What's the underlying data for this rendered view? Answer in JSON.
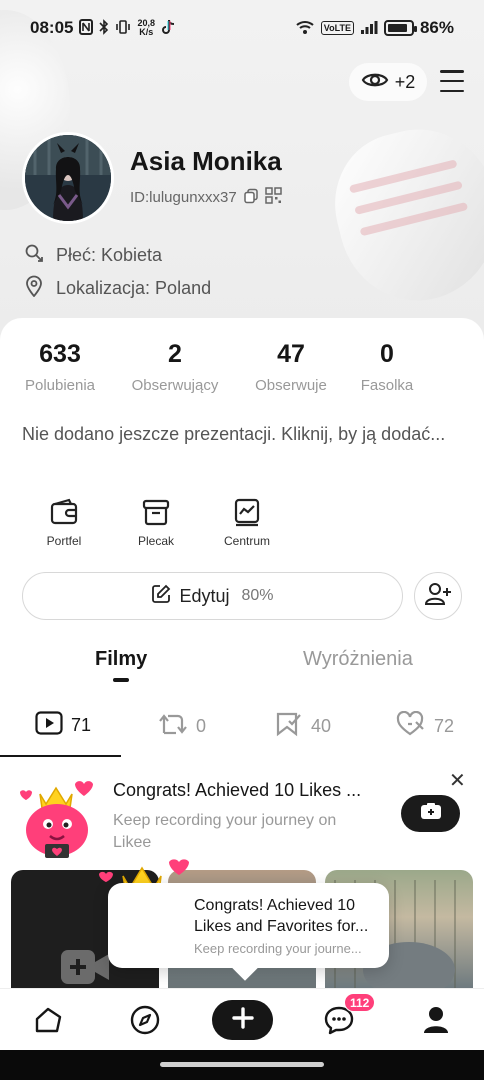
{
  "status_bar": {
    "time": "08:05",
    "net_speed_value": "20,8",
    "net_speed_unit": "K/s",
    "volte": "VoLTE",
    "battery": "86%",
    "battery_level": 0.86
  },
  "header": {
    "visitors_count": "+2"
  },
  "profile": {
    "name": "Asia Monika",
    "id": "ID:lulugunxxx37",
    "gender": "Płeć: Kobieta",
    "location": "Lokalizacja: Poland"
  },
  "stats": [
    {
      "value": "633",
      "label": "Polubienia"
    },
    {
      "value": "2",
      "label": "Obserwujący"
    },
    {
      "value": "47",
      "label": "Obserwuje"
    },
    {
      "value": "0",
      "label": "Fasolka"
    }
  ],
  "bio": "Nie dodano jeszcze prezentacji. Kliknij, by ją dodać...",
  "tools": [
    {
      "label": "Portfel",
      "icon": "wallet-icon"
    },
    {
      "label": "Plecak",
      "icon": "backpack-icon"
    },
    {
      "label": "Centrum",
      "icon": "creator-center-icon"
    }
  ],
  "edit": {
    "label": "Edytuj",
    "percent": "80%"
  },
  "tabs": [
    "Filmy",
    "Wyróżnienia"
  ],
  "subtabs": [
    {
      "icon": "video-icon",
      "count": "71",
      "active": true
    },
    {
      "icon": "repost-icon",
      "count": "0",
      "active": false
    },
    {
      "icon": "bookmark-icon",
      "count": "40",
      "active": false
    },
    {
      "icon": "liked-icon",
      "count": "72",
      "active": false
    }
  ],
  "congrats_banner": {
    "title": "Congrats! Achieved 10 Likes ...",
    "subtitle": "Keep recording your journey on Likee"
  },
  "toast": {
    "title": "Congrats! Achieved 10 Likes and Favorites for...",
    "subtitle": "Keep recording your journe..."
  },
  "bottom_nav": {
    "items": [
      "home-icon",
      "discover-icon",
      "add-icon",
      "messages-icon",
      "profile-icon"
    ],
    "messages_badge": "112"
  },
  "colors": {
    "accent_pink": "#ff3f7a",
    "dark": "#161616",
    "muted": "#999999"
  }
}
